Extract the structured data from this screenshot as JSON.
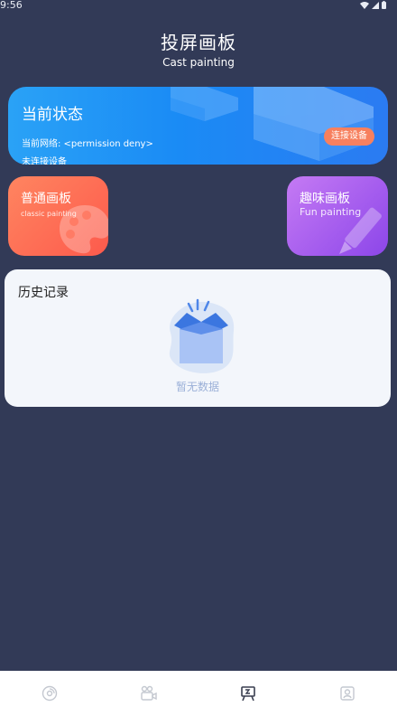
{
  "status_bar": {
    "time": "9:56"
  },
  "header": {
    "title": "投屏画板",
    "subtitle": "Cast painting"
  },
  "status_card": {
    "title": "当前状态",
    "network_label": "当前网络: <permission deny>",
    "device_status": "未连接设备",
    "connect_button": "连接设备"
  },
  "boards": {
    "normal": {
      "title": "普通画板",
      "subtitle": "classic painting"
    },
    "fun": {
      "title": "趣味画板",
      "subtitle": "Fun painting"
    }
  },
  "history": {
    "title": "历史记录",
    "empty_text": "暂无数据"
  },
  "bottom_nav": {
    "items": [
      {
        "icon": "disc-icon"
      },
      {
        "icon": "camera-icon"
      },
      {
        "icon": "easel-icon"
      },
      {
        "icon": "profile-icon"
      }
    ]
  },
  "colors": {
    "background": "#323a57",
    "status_card_accent": "#1a8bf5",
    "connect_button": "#f7805e",
    "normal_board": "#fd5a4c",
    "fun_board": "#8c46e9"
  }
}
